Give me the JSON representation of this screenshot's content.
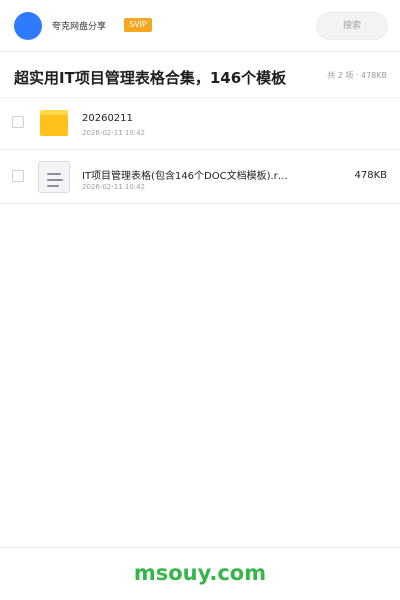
{
  "header": {
    "brand_name": "夸克网盘分享",
    "vip_badge": "SVIP",
    "search_label": "搜索"
  },
  "share": {
    "title": "超实用IT项目管理表格合集，146个模板",
    "summary": "共 2 项 · 478KB"
  },
  "files": [
    {
      "name": "20260211",
      "time": "2026-02-11 10:42",
      "size": "",
      "icon": "folder-icon"
    },
    {
      "name": "IT项目管理表格(包含146个DOC文档模板).r…",
      "time": "2026-02-11 10:42",
      "size": "478KB",
      "icon": "document-icon"
    }
  ],
  "footer": {
    "watermark": "msouy.com"
  },
  "colors": {
    "accent_blue": "#2f7bff",
    "vip_orange": "#f5a623",
    "folder_yellow": "#ffc21a",
    "watermark_green": "#35b64a"
  }
}
